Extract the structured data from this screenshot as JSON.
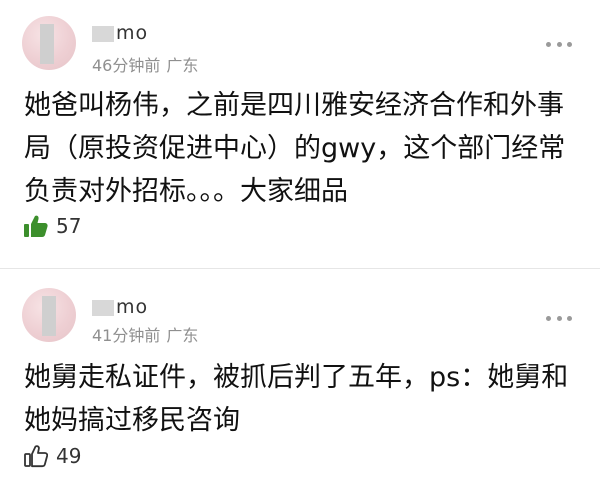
{
  "comments": [
    {
      "username": "mo",
      "time": "46分钟前",
      "location": "广东",
      "text": "她爸叫杨伟，之前是四川雅安经济合作和外事局（原投资促进中心）的gwy，这个部门经常负责对外招标。。。大家细品",
      "likes": "57",
      "liked": true,
      "like_icon": "thumbs-up-filled-icon",
      "like_color": "#3c8f2c"
    },
    {
      "username": "mo",
      "time": "41分钟前",
      "location": "广东",
      "text": "她舅走私证件，被抓后判了五年，ps：她舅和她妈搞过移民咨询",
      "likes": "49",
      "liked": false,
      "like_icon": "thumbs-up-outline-icon",
      "like_color": "#333333"
    }
  ],
  "icons": {
    "more": "more-dots-icon",
    "avatar": "avatar"
  }
}
